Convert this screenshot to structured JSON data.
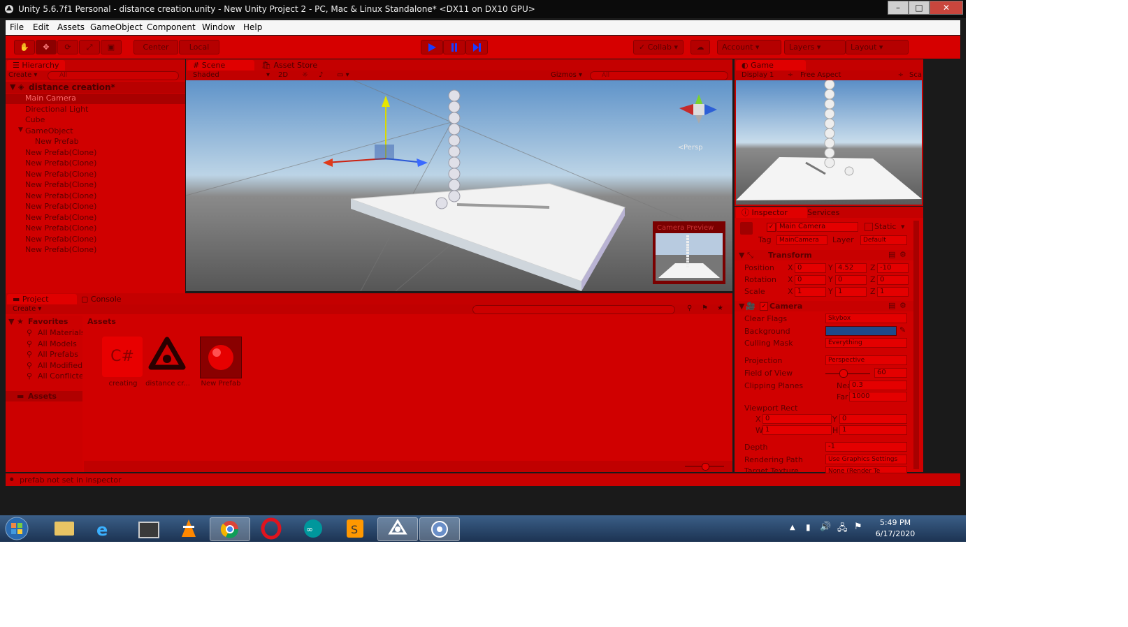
{
  "window": {
    "title": "Unity 5.6.7f1 Personal - distance creation.unity - New Unity Project 2 - PC, Mac & Linux Standalone* <DX11 on DX10 GPU>"
  },
  "menu": [
    "File",
    "Edit",
    "Assets",
    "GameObject",
    "Component",
    "Window",
    "Help"
  ],
  "toolbar": {
    "pivot": "Center",
    "space": "Local",
    "collab": "Collab",
    "account": "Account",
    "layers": "Layers",
    "layout": "Layout"
  },
  "hierarchy": {
    "tab": "Hierarchy",
    "create": "Create",
    "search_placeholder": "All",
    "scene": "distance creation*",
    "items": [
      {
        "label": "Main Camera",
        "selected": true
      },
      {
        "label": "Directional Light"
      },
      {
        "label": "Cube"
      },
      {
        "label": "GameObject"
      },
      {
        "label": "New Prefab"
      },
      {
        "label": "New Prefab(Clone)"
      },
      {
        "label": "New Prefab(Clone)"
      },
      {
        "label": "New Prefab(Clone)"
      },
      {
        "label": "New Prefab(Clone)"
      },
      {
        "label": "New Prefab(Clone)"
      },
      {
        "label": "New Prefab(Clone)"
      },
      {
        "label": "New Prefab(Clone)"
      },
      {
        "label": "New Prefab(Clone)"
      },
      {
        "label": "New Prefab(Clone)"
      },
      {
        "label": "New Prefab(Clone)"
      }
    ]
  },
  "scene": {
    "tab_scene": "Scene",
    "tab_store": "Asset Store",
    "shading": "Shaded",
    "mode2d": "2D",
    "gizmos": "Gizmos",
    "search_placeholder": "All",
    "persp": "Persp",
    "camera_preview": "Camera Preview"
  },
  "game": {
    "tab": "Game",
    "display": "Display 1",
    "aspect": "Free Aspect",
    "scale": "Sca"
  },
  "inspector": {
    "tab": "Inspector",
    "tab_services": "Services",
    "name": "Main Camera",
    "static": "Static",
    "tag_label": "Tag",
    "tag": "MainCamera",
    "layer_label": "Layer",
    "layer": "Default",
    "transform": {
      "title": "Transform",
      "position_label": "Position",
      "position": {
        "x": "0",
        "y": "4.52",
        "z": "-10"
      },
      "rotation_label": "Rotation",
      "rotation": {
        "x": "0",
        "y": "0",
        "z": "0"
      },
      "scale_label": "Scale",
      "scale": {
        "x": "1",
        "y": "1",
        "z": "1"
      }
    },
    "camera": {
      "title": "Camera",
      "clear_flags_label": "Clear Flags",
      "clear_flags": "Skybox",
      "background_label": "Background",
      "culling_label": "Culling Mask",
      "culling": "Everything",
      "projection_label": "Projection",
      "projection": "Perspective",
      "fov_label": "Field of View",
      "fov": "60",
      "clipping_label": "Clipping Planes",
      "near_label": "Near",
      "near": "0.3",
      "far_label": "Far",
      "far": "1000",
      "viewport_label": "Viewport Rect",
      "vx": "0",
      "vy": "0",
      "vw": "1",
      "vh": "1",
      "depth_label": "Depth",
      "depth": "-1",
      "rendering_label": "Rendering Path",
      "rendering": "Use Graphics Settings",
      "target_label": "Target Texture",
      "target": "None (Render Te"
    }
  },
  "project": {
    "tab": "Project",
    "tab_console": "Console",
    "create": "Create",
    "favorites": "Favorites",
    "fav_items": [
      "All Materials",
      "All Models",
      "All Prefabs",
      "All Modified",
      "All Conflicted"
    ],
    "assets_root": "Assets",
    "assets_header": "Assets",
    "assets": [
      {
        "label": "creating",
        "icon": "csharp-script-icon",
        "glyph": "C#"
      },
      {
        "label": "distance cr...",
        "icon": "unity-scene-icon",
        "glyph": ""
      },
      {
        "label": "New Prefab",
        "icon": "prefab-sphere-icon",
        "glyph": ""
      }
    ]
  },
  "status": {
    "message": "prefab not set in inspector"
  },
  "taskbar": {
    "time": "5:49 PM",
    "date": "6/17/2020"
  },
  "colors": {
    "accent": "#d00000",
    "camera_background": "#1f4a8a",
    "play": "#1a3cff"
  }
}
